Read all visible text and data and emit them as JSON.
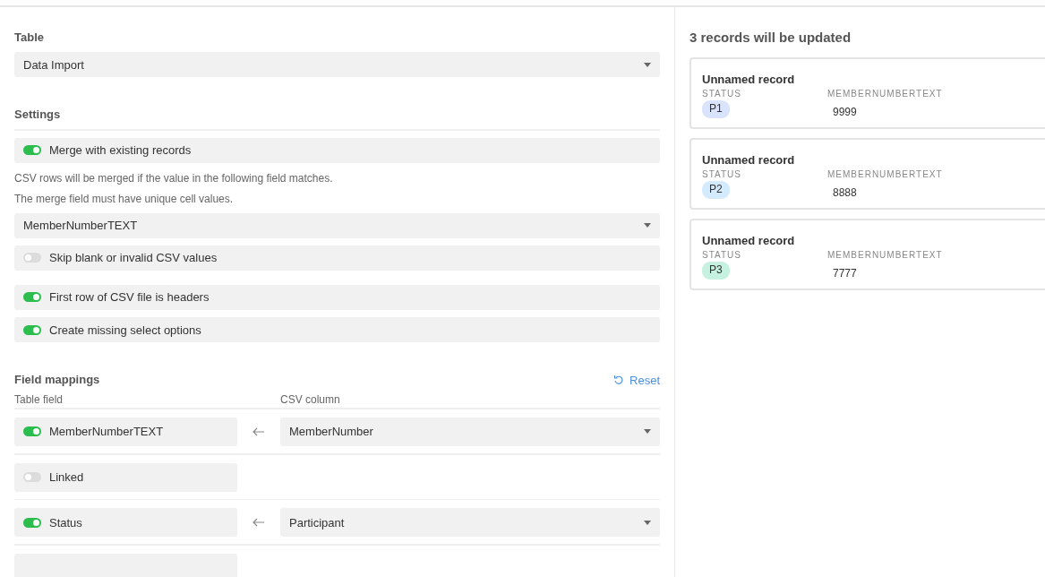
{
  "table": {
    "label": "Table",
    "value": "Data Import"
  },
  "settings": {
    "heading": "Settings",
    "merge": {
      "label": "Merge with existing records",
      "on": true
    },
    "help": [
      "CSV rows will be merged if the value in the following field matches.",
      "The merge field must have unique cell values."
    ],
    "merge_field": "MemberNumberTEXT",
    "skip": {
      "label": "Skip blank or invalid CSV values",
      "on": false
    },
    "options": [
      {
        "label": "First row of CSV file is headers",
        "on": true
      },
      {
        "label": "Create missing select options",
        "on": true
      }
    ]
  },
  "field_mappings": {
    "heading": "Field mappings",
    "reset": "Reset",
    "table_field_header": "Table field",
    "csv_column_header": "CSV column",
    "rows": [
      {
        "kind": "mapped",
        "field": "MemberNumberTEXT",
        "on": true,
        "csv_column": "MemberNumber"
      },
      {
        "kind": "unmapped",
        "field": "Linked",
        "on": false
      },
      {
        "kind": "mapped",
        "field": "Status",
        "on": true,
        "csv_column": "Participant"
      },
      {
        "kind": "partial"
      }
    ]
  },
  "preview": {
    "title": "3 records will be updated",
    "records": [
      {
        "name": "Unnamed record",
        "status_label": "STATUS",
        "status": "P1",
        "color": "#d9e3fb",
        "number_label": "MEMBERNUMBERTEXT",
        "number": "9999"
      },
      {
        "name": "Unnamed record",
        "status_label": "STATUS",
        "status": "P2",
        "color": "#d3ebfc",
        "number_label": "MEMBERNUMBERTEXT",
        "number": "8888"
      },
      {
        "name": "Unnamed record",
        "status_label": "STATUS",
        "status": "P3",
        "color": "#c6f1e1",
        "number_label": "MEMBERNUMBERTEXT",
        "number": "7777"
      }
    ]
  }
}
